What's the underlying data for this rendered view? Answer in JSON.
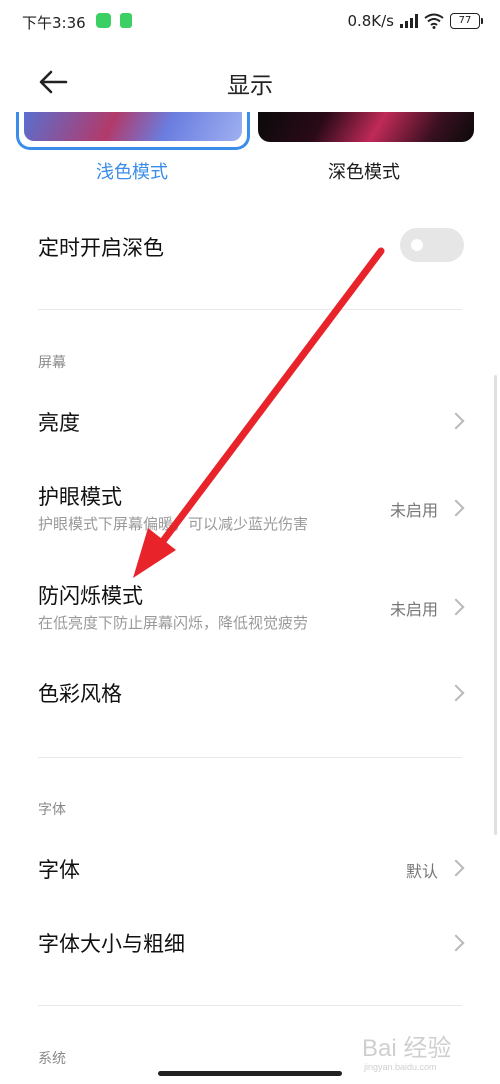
{
  "status_bar": {
    "time": "下午3:36",
    "net_speed": "0.8K/s",
    "battery": "77"
  },
  "header": {
    "title": "显示",
    "back_icon": "arrow-left-icon"
  },
  "theme": {
    "light_label": "浅色模式",
    "dark_label": "深色模式",
    "selected": "浅色模式",
    "accent_color": "#3a8de8"
  },
  "dark_schedule": {
    "label": "定时开启深色",
    "enabled": false
  },
  "sections": {
    "screen": {
      "header": "屏幕",
      "items": [
        {
          "title": "亮度"
        },
        {
          "title": "护眼模式",
          "subtitle": "护眼模式下屏幕偏暖，可以减少蓝光伤害",
          "value": "未启用"
        },
        {
          "title": "防闪烁模式",
          "subtitle": "在低亮度下防止屏幕闪烁，降低视觉疲劳",
          "value": "未启用"
        },
        {
          "title": "色彩风格"
        }
      ]
    },
    "font": {
      "header": "字体",
      "items": [
        {
          "title": "字体",
          "value": "默认"
        },
        {
          "title": "字体大小与粗细"
        }
      ]
    },
    "system": {
      "header": "系统"
    }
  },
  "annotation": {
    "color": "#e8242a"
  },
  "watermark": {
    "text": "Bai 经验",
    "url": "jingyan.baidu.com"
  }
}
